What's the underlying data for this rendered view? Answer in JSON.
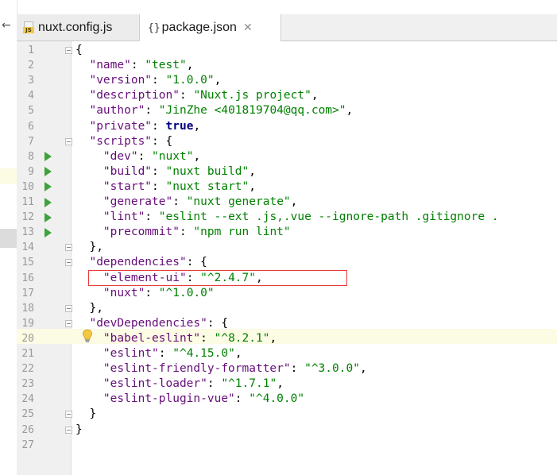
{
  "tabs": [
    {
      "label": "nuxt.config.js",
      "icon": "js-file-icon",
      "active": false
    },
    {
      "label": "package.json",
      "icon": "json-file-icon",
      "active": true,
      "close": "✕"
    }
  ],
  "json_icon_text": "{}",
  "js_icon_text": "JS",
  "colors": {
    "key": "#660e7a",
    "string": "#008000",
    "keyword": "#000080",
    "run": "#3ea33e",
    "highlight": "#fcfbe3",
    "error_box": "#e83b3b"
  },
  "lines": [
    {
      "n": "1",
      "indent": "",
      "open": "{"
    },
    {
      "n": "2",
      "indent": "  ",
      "key": "\"name\"",
      "sep": ": ",
      "str": "\"test\"",
      "end": ","
    },
    {
      "n": "3",
      "indent": "  ",
      "key": "\"version\"",
      "sep": ": ",
      "str": "\"1.0.0\"",
      "end": ","
    },
    {
      "n": "4",
      "indent": "  ",
      "key": "\"description\"",
      "sep": ": ",
      "str": "\"Nuxt.js project\"",
      "end": ","
    },
    {
      "n": "5",
      "indent": "  ",
      "key": "\"author\"",
      "sep": ": ",
      "str": "\"JinZhe <401819704@qq.com>\"",
      "end": ","
    },
    {
      "n": "6",
      "indent": "  ",
      "key": "\"private\"",
      "sep": ": ",
      "kw": "true",
      "end": ","
    },
    {
      "n": "7",
      "indent": "  ",
      "key": "\"scripts\"",
      "sep": ": ",
      "open": "{"
    },
    {
      "n": "8",
      "indent": "    ",
      "key": "\"dev\"",
      "sep": ": ",
      "str": "\"nuxt\"",
      "end": ","
    },
    {
      "n": "9",
      "indent": "    ",
      "key": "\"build\"",
      "sep": ": ",
      "str": "\"nuxt build\"",
      "end": ","
    },
    {
      "n": "10",
      "indent": "    ",
      "key": "\"start\"",
      "sep": ": ",
      "str": "\"nuxt start\"",
      "end": ","
    },
    {
      "n": "11",
      "indent": "    ",
      "key": "\"generate\"",
      "sep": ": ",
      "str": "\"nuxt generate\"",
      "end": ","
    },
    {
      "n": "12",
      "indent": "    ",
      "key": "\"lint\"",
      "sep": ": ",
      "str": "\"eslint --ext .js,.vue --ignore-path .gitignore .",
      "end": ""
    },
    {
      "n": "13",
      "indent": "    ",
      "key": "\"precommit\"",
      "sep": ": ",
      "str": "\"npm run lint\"",
      "end": ""
    },
    {
      "n": "14",
      "indent": "  ",
      "close": "},"
    },
    {
      "n": "15",
      "indent": "  ",
      "key": "\"dependencies\"",
      "sep": ": ",
      "open": "{"
    },
    {
      "n": "16",
      "indent": "    ",
      "key": "\"element-ui\"",
      "sep": ": ",
      "str": "\"^2.4.7\"",
      "end": ","
    },
    {
      "n": "17",
      "indent": "    ",
      "key": "\"nuxt\"",
      "sep": ": ",
      "str": "\"^1.0.0\"",
      "end": ""
    },
    {
      "n": "18",
      "indent": "  ",
      "close": "},"
    },
    {
      "n": "19",
      "indent": "  ",
      "key": "\"devDependencies\"",
      "sep": ": ",
      "open": "{"
    },
    {
      "n": "20",
      "indent": "    ",
      "key": "\"babel-eslint\"",
      "sep": ": ",
      "str": "\"^8.2.1\"",
      "end": ","
    },
    {
      "n": "21",
      "indent": "    ",
      "key": "\"eslint\"",
      "sep": ": ",
      "str": "\"^4.15.0\"",
      "end": ","
    },
    {
      "n": "22",
      "indent": "    ",
      "key": "\"eslint-friendly-formatter\"",
      "sep": ": ",
      "str": "\"^3.0.0\"",
      "end": ","
    },
    {
      "n": "23",
      "indent": "    ",
      "key": "\"eslint-loader\"",
      "sep": ": ",
      "str": "\"^1.7.1\"",
      "end": ","
    },
    {
      "n": "24",
      "indent": "    ",
      "key": "\"eslint-plugin-vue\"",
      "sep": ": ",
      "str": "\"^4.0.0\"",
      "end": ""
    },
    {
      "n": "25",
      "indent": "  ",
      "close": "}"
    },
    {
      "n": "26",
      "indent": "",
      "close": "}"
    },
    {
      "n": "27",
      "indent": ""
    }
  ],
  "left_arrow": "←"
}
